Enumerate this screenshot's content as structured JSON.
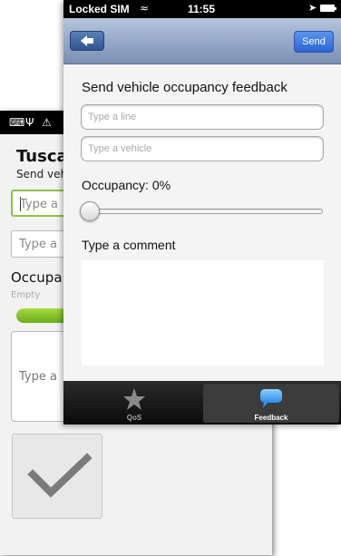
{
  "android": {
    "title": "Tusca",
    "subtitle": "Send veh",
    "line_input": "Type a",
    "vehicle_input": "Type a",
    "occupancy_label": "Occupa",
    "empty_label": "Empty",
    "occupancy_value": 0,
    "comment_input": "Type a",
    "colors": {
      "accent": "#8ec24a",
      "bar": "#7ab82a"
    },
    "icons": [
      "keyboard-icon",
      "usb-icon",
      "warning-icon",
      "check-icon"
    ]
  },
  "ios": {
    "status_bar": {
      "carrier": "Locked SIM",
      "time": "11:55"
    },
    "nav": {
      "send_label": "Send"
    },
    "heading": "Send vehicle occupancy feedback",
    "line_placeholder": "Type a line",
    "vehicle_placeholder": "Type a vehicle",
    "occupancy_label": "Occupancy:  0%",
    "occupancy_value": 0,
    "comment_label": "Type a comment",
    "tabs": [
      {
        "label": "QoS",
        "icon": "star-icon",
        "selected": false
      },
      {
        "label": "Feedback",
        "icon": "speech-bubble-icon",
        "selected": true
      }
    ],
    "colors": {
      "nav_bar": "#90a4c4",
      "send_button": "#3d75e0",
      "tab_selected": "#3b3b3b"
    }
  }
}
